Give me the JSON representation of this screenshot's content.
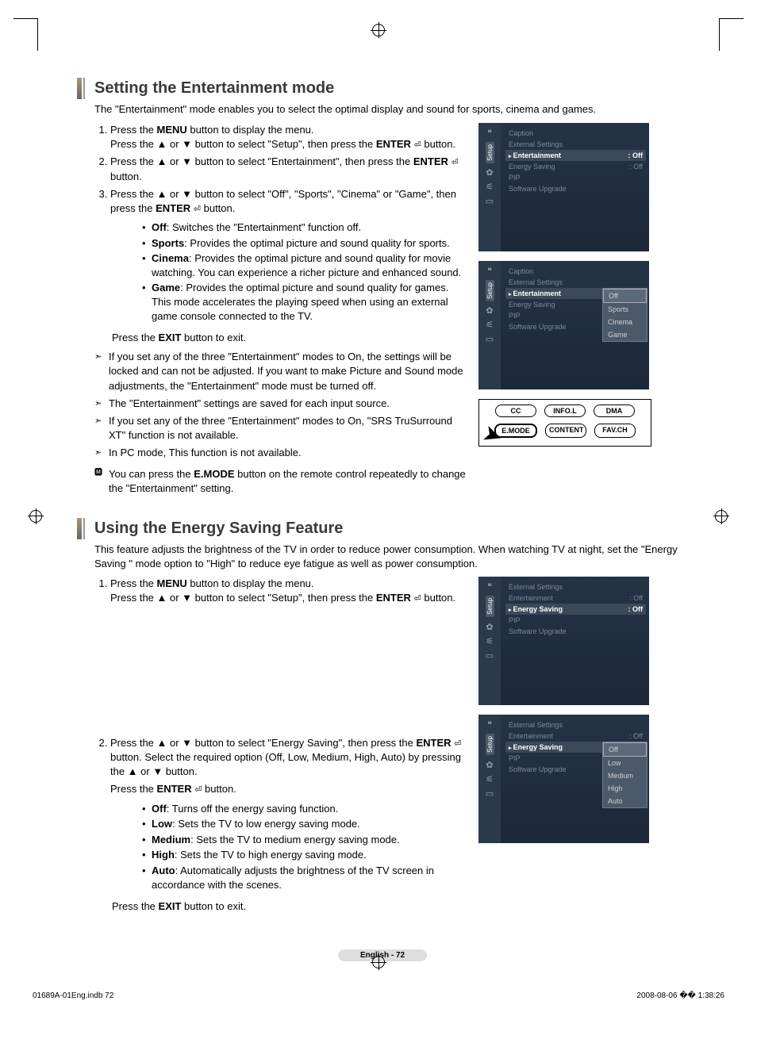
{
  "section1": {
    "title": "Setting the Entertainment mode",
    "intro": "The \"Entertainment\" mode enables you to select the optimal display and sound for sports, cinema and games.",
    "step1a": "Press the ",
    "step1a_b": "MENU",
    "step1a_end": " button to display the menu.",
    "step1b": "Press the ▲ or ▼ button to select \"Setup\", then press the ",
    "step1b_b": "ENTER",
    "step1b_end": " button.",
    "step2": "Press the ▲ or ▼ button to select \"Entertainment\", then press the ",
    "step2_b": "ENTER",
    "step2_end": " button.",
    "step3": "Press the ▲ or ▼ button to select \"Off\", \"Sports\", \"Cinema\" or \"Game\", then press the ",
    "step3_b": "ENTER",
    "step3_end": " button.",
    "opt_off_b": "Off",
    "opt_off": ": Switches the \"Entertainment\" function off.",
    "opt_sports_b": "Sports",
    "opt_sports": ": Provides the optimal picture and sound quality for sports.",
    "opt_cinema_b": "Cinema",
    "opt_cinema": ": Provides the optimal picture and sound quality for movie watching. You can experience a richer picture and enhanced sound.",
    "opt_game_b": "Game",
    "opt_game": ": Provides the optimal picture and sound quality for games. This mode accelerates the playing speed when using an external game console connected to the TV.",
    "exit_a": "Press the ",
    "exit_b": "EXIT",
    "exit_c": " button to exit.",
    "note1": "If you set any of the three \"Entertainment\" modes to On, the settings will be locked and can not be adjusted. If you want to make Picture and Sound mode adjustments, the \"Entertainment\" mode must be turned off.",
    "note2": "The \"Entertainment\" settings are saved for each input source.",
    "note3": "If you set any of the three \"Entertainment\" modes to On, \"SRS TruSurround XT\" function is not available.",
    "note4": "In PC mode, This function is not available.",
    "remote_note_a": "You can press the ",
    "remote_note_b": "E.MODE",
    "remote_note_c": " button on the remote control repeatedly to change the \"Entertainment\" setting."
  },
  "section2": {
    "title": "Using the Energy Saving Feature",
    "intro": "This feature adjusts the brightness of the TV in order to reduce power consumption. When watching TV at night, set the \"Energy Saving \" mode option to \"High\" to reduce eye fatigue as well as power consumption.",
    "step1a": "Press the ",
    "step1a_b": "MENU",
    "step1a_end": " button to display the menu.",
    "step1b": "Press the ▲ or ▼ button to select \"Setup\", then press the ",
    "step1b_b": "ENTER",
    "step1b_end": " button.",
    "step2": "Press the ▲ or ▼ button to select \"Energy Saving\", then press the ",
    "step2_b": "ENTER",
    "step2_end": " button. Select the required option (Off, Low, Medium, High, Auto) by pressing the ▲ or ▼ button.",
    "step2p2a": "Press the ",
    "step2p2b": "ENTER",
    "step2p2c": " button.",
    "opt_off_b": "Off",
    "opt_off": ": Turns off the energy saving function.",
    "opt_low_b": "Low",
    "opt_low": ": Sets the TV to low energy saving mode.",
    "opt_med_b": "Medium",
    "opt_med": ": Sets the TV to medium energy saving mode.",
    "opt_high_b": "High",
    "opt_high": ": Sets the TV to high energy saving mode.",
    "opt_auto_b": "Auto",
    "opt_auto": ": Automatically adjusts the brightness of the TV screen in accordance with the scenes.",
    "exit_a": "Press the ",
    "exit_b": "EXIT",
    "exit_c": " button to exit."
  },
  "osd": {
    "setup": "Setup",
    "caption": "Caption",
    "external": "External Settings",
    "entertainment": "Entertainment",
    "energy": "Energy Saving",
    "pip": "PIP",
    "upgrade": "Software Upgrade",
    "off": ": Off",
    "off_plain": "Off",
    "sports": "Sports",
    "cinema": "Cinema",
    "game": "Game",
    "low": "Low",
    "medium": "Medium",
    "high": "High",
    "auto": "Auto"
  },
  "remote": {
    "cc": "CC",
    "info": "INFO.L",
    "dma": "DMA",
    "emode": "E.MODE",
    "content": "CONTENT",
    "favch": "FAV.CH"
  },
  "footer": {
    "page": "English - 72",
    "file": "01689A-01Eng.indb   72",
    "timestamp": "2008-08-06   �� 1:38:26"
  },
  "icon": "⏎"
}
